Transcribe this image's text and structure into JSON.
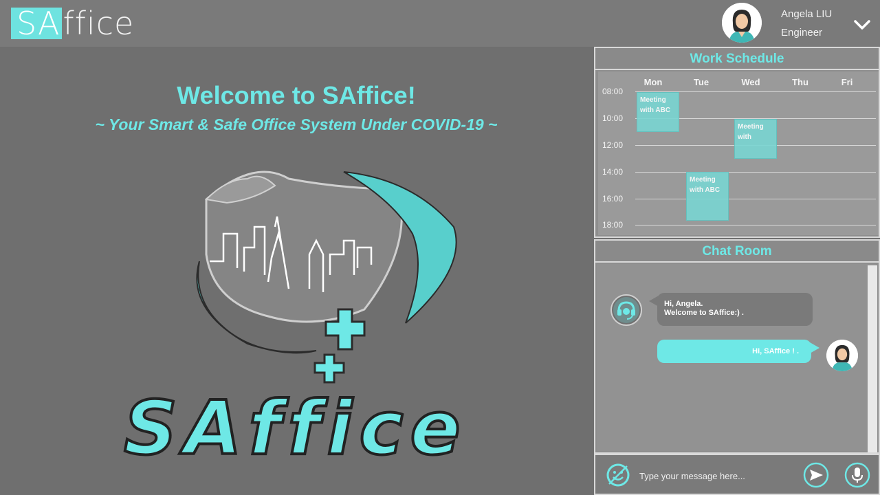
{
  "app": {
    "logo_prefix": "SA",
    "logo_suffix": "ffice"
  },
  "user": {
    "name": "Angela LIU",
    "role": "Engineer"
  },
  "hero": {
    "welcome": "Welcome to SAffice!",
    "tagline": "~ Your Smart & Safe Office System Under COVID-19 ~",
    "logo_text": "SAffice"
  },
  "schedule": {
    "title": "Work Schedule",
    "days": [
      "Mon",
      "Tue",
      "Wed",
      "Thu",
      "Fri"
    ],
    "times": [
      "08:00",
      "10:00",
      "12:00",
      "14:00",
      "16:00",
      "18:00"
    ],
    "events": [
      {
        "day": "Mon",
        "start": "08:00",
        "end": "11:00",
        "text": "Meeting with ABC"
      },
      {
        "day": "Wed",
        "start": "10:00",
        "end": "13:00",
        "text": "Meeting with"
      },
      {
        "day": "Tue",
        "start": "14:00",
        "end": "17:40",
        "text": "Meeting with ABC"
      }
    ]
  },
  "chat": {
    "title": "Chat Room",
    "messages": [
      {
        "from": "bot",
        "line1": "Hi, Angela.",
        "line2": "Welcome to SAffice:) ."
      },
      {
        "from": "user",
        "text": "Hi, SAffice ! ."
      }
    ],
    "input_placeholder": "Type your message here..."
  },
  "colors": {
    "accent": "#6ee8e6",
    "background": "#6f6f6f",
    "panel": "#8e8e8e"
  },
  "icons": {
    "dropdown": "chevron-down-icon",
    "assistant": "headset-icon",
    "emoji": "emoji-icon",
    "send": "send-icon",
    "mic": "microphone-icon"
  }
}
